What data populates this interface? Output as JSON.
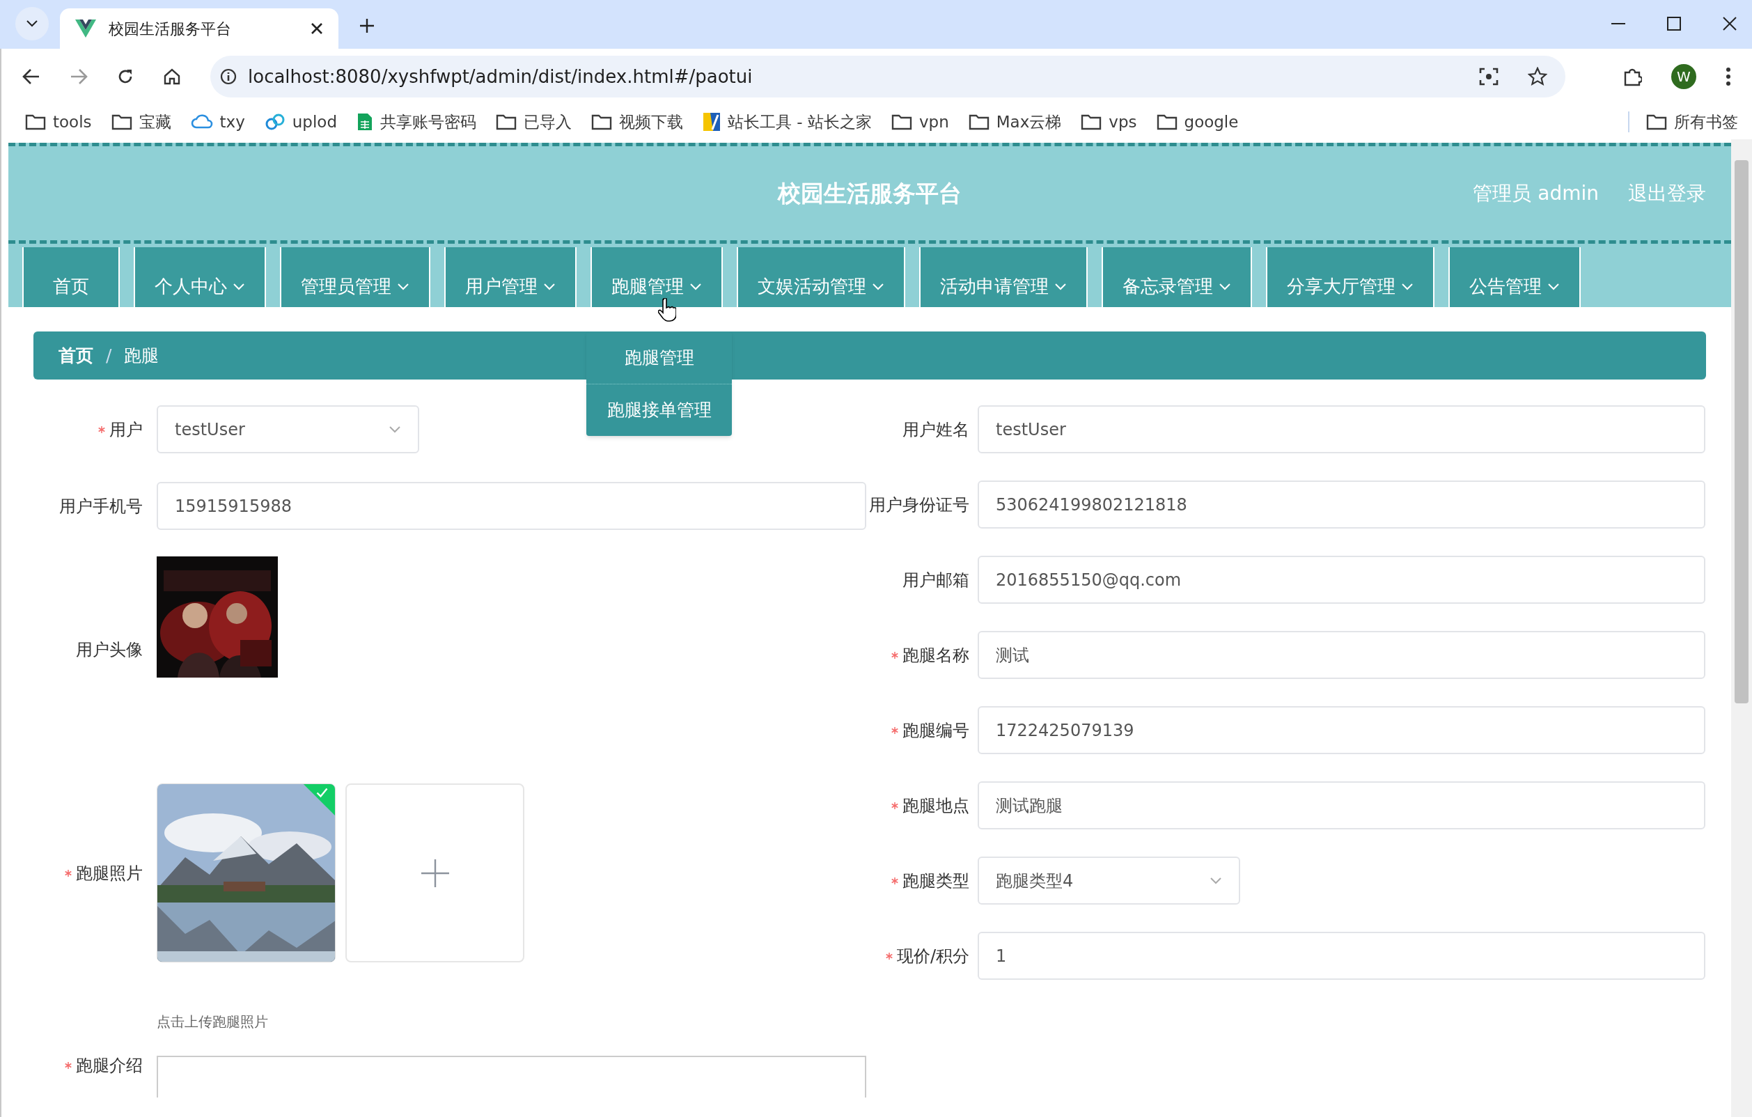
{
  "browser": {
    "tab_title": "校园生活服务平台",
    "url": "localhost:8080/xyshfwpt/admin/dist/index.html#/paotui",
    "profile": "W",
    "bookmarks": [
      {
        "label": "tools",
        "kind": "folder"
      },
      {
        "label": "宝藏",
        "kind": "folder"
      },
      {
        "label": "txy",
        "kind": "cloud"
      },
      {
        "label": "uplod",
        "kind": "swirl"
      },
      {
        "label": "共享账号密码",
        "kind": "sheet"
      },
      {
        "label": "已导入",
        "kind": "folder"
      },
      {
        "label": "视频下载",
        "kind": "folder"
      },
      {
        "label": "站长工具 - 站长之家",
        "kind": "site"
      },
      {
        "label": "vpn",
        "kind": "folder"
      },
      {
        "label": "Max云梯",
        "kind": "folder"
      },
      {
        "label": "vps",
        "kind": "folder"
      },
      {
        "label": "google",
        "kind": "folder"
      }
    ],
    "all_bookmarks": "所有书签"
  },
  "header": {
    "title": "校园生活服务平台",
    "user": "管理员 admin",
    "logout": "退出登录"
  },
  "nav": [
    {
      "label": "首页",
      "dropdown": false
    },
    {
      "label": "个人中心",
      "dropdown": true
    },
    {
      "label": "管理员管理",
      "dropdown": true
    },
    {
      "label": "用户管理",
      "dropdown": true
    },
    {
      "label": "跑腿管理",
      "dropdown": true
    },
    {
      "label": "文娱活动管理",
      "dropdown": true
    },
    {
      "label": "活动申请管理",
      "dropdown": true
    },
    {
      "label": "备忘录管理",
      "dropdown": true
    },
    {
      "label": "分享大厅管理",
      "dropdown": true
    },
    {
      "label": "公告管理",
      "dropdown": true
    }
  ],
  "dropdown_menu": [
    "跑腿管理",
    "跑腿接单管理"
  ],
  "breadcrumb": {
    "separator": "/",
    "items": [
      "首页",
      "跑腿"
    ]
  },
  "form": {
    "left_fields": [
      {
        "label": "用户",
        "required": true,
        "kind": "select",
        "value": "testUser"
      },
      {
        "label": "用户手机号",
        "required": false,
        "kind": "text",
        "value": "15915915988"
      },
      {
        "label": "用户头像",
        "required": false
      },
      {
        "label": "跑腿照片",
        "required": true,
        "kind": "upload",
        "uploaded": true,
        "hint": "点击上传跑腿照片"
      },
      {
        "label": "跑腿介绍",
        "required": true,
        "kind": "editor"
      }
    ],
    "right_fields": [
      {
        "label": "用户姓名",
        "required": false,
        "kind": "text",
        "value": "testUser"
      },
      {
        "label": "用户身份证号",
        "required": false,
        "kind": "text",
        "value": "530624199802121818"
      },
      {
        "label": "用户邮箱",
        "required": false,
        "kind": "text",
        "value": "2016855150@qq.com"
      },
      {
        "label": "跑腿名称",
        "required": true,
        "kind": "text",
        "value": "测试"
      },
      {
        "label": "跑腿编号",
        "required": true,
        "kind": "text",
        "value": "1722425079139"
      },
      {
        "label": "跑腿地点",
        "required": true,
        "kind": "text",
        "value": "测试跑腿"
      },
      {
        "label": "跑腿类型",
        "required": true,
        "kind": "select",
        "value": "跑腿类型4"
      },
      {
        "label": "现价/积分",
        "required": true,
        "kind": "text",
        "value": "1"
      }
    ]
  }
}
